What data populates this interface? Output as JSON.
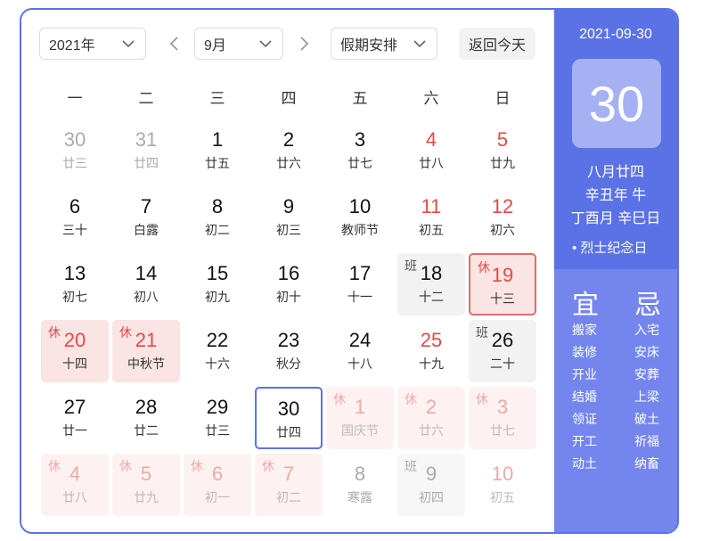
{
  "toolbar": {
    "year_label": "2021年",
    "month_label": "9月",
    "holiday_label": "假期安排",
    "today_label": "返回今天"
  },
  "weekdays": [
    "一",
    "二",
    "三",
    "四",
    "五",
    "六",
    "日"
  ],
  "days": [
    {
      "n": "30",
      "l": "廿三",
      "s": "gray"
    },
    {
      "n": "31",
      "l": "廿四",
      "s": "gray"
    },
    {
      "n": "1",
      "l": "廿五",
      "s": ""
    },
    {
      "n": "2",
      "l": "廿六",
      "s": ""
    },
    {
      "n": "3",
      "l": "廿七",
      "s": ""
    },
    {
      "n": "4",
      "l": "廿八",
      "s": "red"
    },
    {
      "n": "5",
      "l": "廿九",
      "s": "red"
    },
    {
      "n": "6",
      "l": "三十",
      "s": ""
    },
    {
      "n": "7",
      "l": "白露",
      "s": ""
    },
    {
      "n": "8",
      "l": "初二",
      "s": ""
    },
    {
      "n": "9",
      "l": "初三",
      "s": ""
    },
    {
      "n": "10",
      "l": "教师节",
      "s": ""
    },
    {
      "n": "11",
      "l": "初五",
      "s": "red"
    },
    {
      "n": "12",
      "l": "初六",
      "s": "red"
    },
    {
      "n": "13",
      "l": "初七",
      "s": ""
    },
    {
      "n": "14",
      "l": "初八",
      "s": ""
    },
    {
      "n": "15",
      "l": "初九",
      "s": ""
    },
    {
      "n": "16",
      "l": "初十",
      "s": ""
    },
    {
      "n": "17",
      "l": "十一",
      "s": ""
    },
    {
      "n": "18",
      "l": "十二",
      "s": "work",
      "t": "班"
    },
    {
      "n": "19",
      "l": "十三",
      "s": "hol outline-red",
      "t": "休"
    },
    {
      "n": "20",
      "l": "十四",
      "s": "hol",
      "t": "休"
    },
    {
      "n": "21",
      "l": "中秋节",
      "s": "hol",
      "t": "休"
    },
    {
      "n": "22",
      "l": "十六",
      "s": ""
    },
    {
      "n": "23",
      "l": "秋分",
      "s": ""
    },
    {
      "n": "24",
      "l": "十八",
      "s": ""
    },
    {
      "n": "25",
      "l": "十九",
      "s": "red"
    },
    {
      "n": "26",
      "l": "二十",
      "s": "work",
      "t": "班"
    },
    {
      "n": "27",
      "l": "廿一",
      "s": ""
    },
    {
      "n": "28",
      "l": "廿二",
      "s": ""
    },
    {
      "n": "29",
      "l": "廿三",
      "s": ""
    },
    {
      "n": "30",
      "l": "廿四",
      "s": "outline-blue"
    },
    {
      "n": "1",
      "l": "国庆节",
      "s": "faint",
      "t": "休"
    },
    {
      "n": "2",
      "l": "廿六",
      "s": "faint",
      "t": "休"
    },
    {
      "n": "3",
      "l": "廿七",
      "s": "faint",
      "t": "休"
    },
    {
      "n": "4",
      "l": "廿八",
      "s": "faint",
      "t": "休"
    },
    {
      "n": "5",
      "l": "廿九",
      "s": "faint",
      "t": "休"
    },
    {
      "n": "6",
      "l": "初一",
      "s": "faint",
      "t": "休"
    },
    {
      "n": "7",
      "l": "初二",
      "s": "faint",
      "t": "休"
    },
    {
      "n": "8",
      "l": "寒露",
      "s": "gray-plain"
    },
    {
      "n": "9",
      "l": "初四",
      "s": "workfaint",
      "t": "班"
    },
    {
      "n": "10",
      "l": "初五",
      "s": "red-faint"
    }
  ],
  "panel": {
    "date": "2021-09-30",
    "day": "30",
    "lunar": "八月廿四",
    "year_gz": "辛丑年 牛",
    "month_day_gz": "丁酉月 辛巳日",
    "festival": "• 烈士纪念日",
    "yi_title": "宜",
    "ji_title": "忌",
    "yi": [
      "搬家",
      "装修",
      "开业",
      "结婚",
      "领证",
      "开工",
      "动土"
    ],
    "ji": [
      "入宅",
      "安床",
      "安葬",
      "上梁",
      "破土",
      "祈福",
      "纳畜"
    ]
  },
  "colors": {
    "accent": "#5b72e6",
    "holiday": "#e24a4a"
  }
}
